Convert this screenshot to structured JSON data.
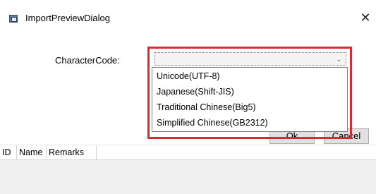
{
  "window": {
    "title": "ImportPreviewDialog",
    "close_glyph": "✕",
    "icon": "app-window-icon"
  },
  "form": {
    "character_code_label": "CharacterCode:",
    "character_code_value": "",
    "options": [
      "Unicode(UTF-8)",
      "Japanese(Shift-JIS)",
      "Traditional Chinese(Big5)",
      "Simplified Chinese(GB2312)"
    ]
  },
  "buttons": {
    "ok_label": "Ok",
    "cancel_label": "Cancel"
  },
  "grid": {
    "columns": [
      "ID",
      "Name",
      "Remarks"
    ]
  },
  "colors": {
    "highlight": "#d52b34",
    "button_bg": "#e1e1e1",
    "grid_body_bg": "#f0f0f0"
  }
}
